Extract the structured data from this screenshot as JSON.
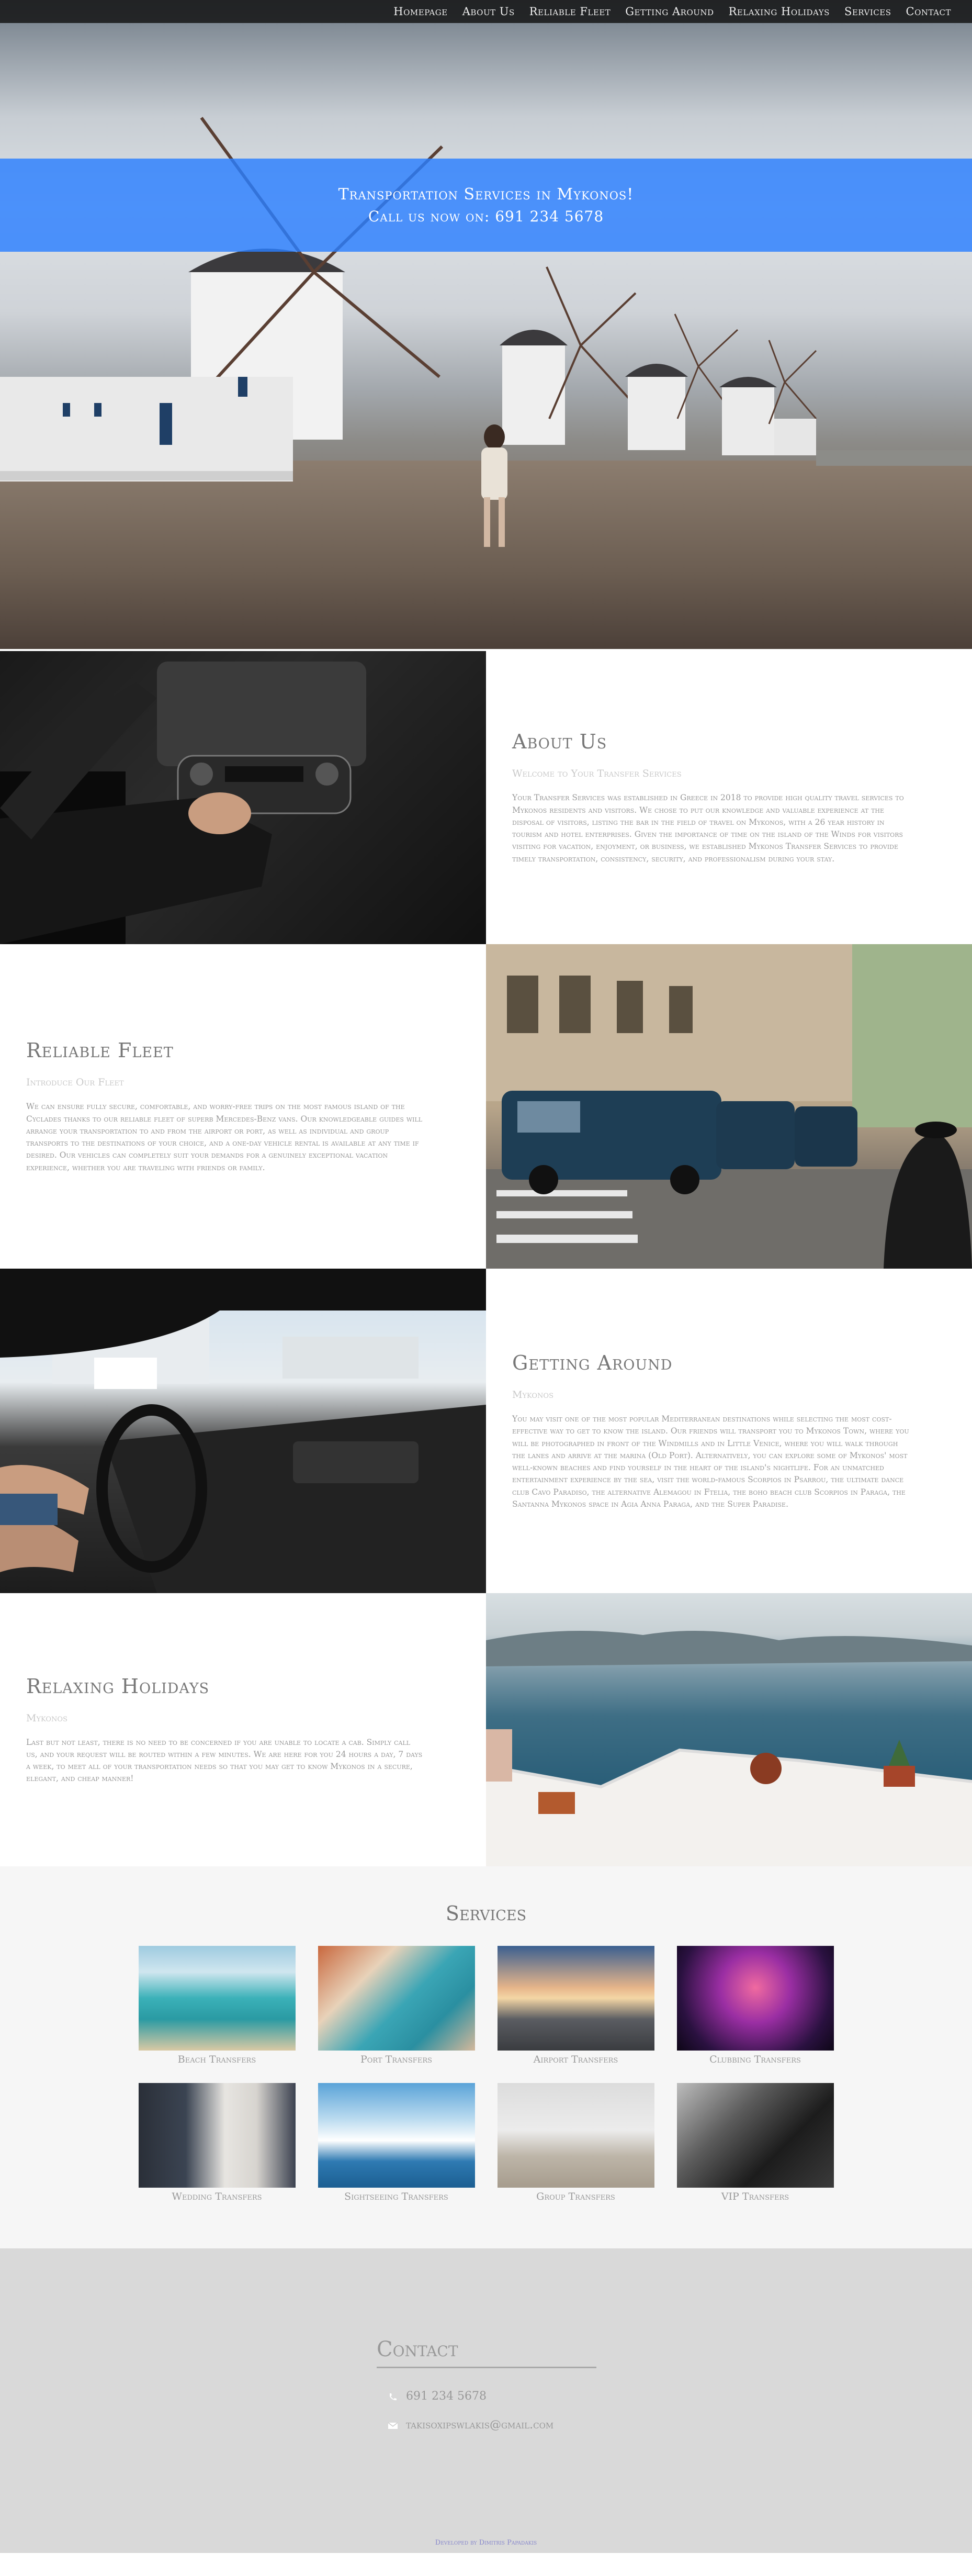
{
  "nav": {
    "items": [
      "Homepage",
      "About Us",
      "Reliable Fleet",
      "Getting Around",
      "Relaxing Holidays",
      "Services",
      "Contact"
    ]
  },
  "hero": {
    "line1": "Transportation Services in Mykonos!",
    "line2": "Call us now on: 691 234 5678"
  },
  "about": {
    "title": "About Us",
    "subtitle": "Welcome to Your Transfer Services",
    "body": "Your Transfer Services was established in Greece in 2018 to provide high quality travel services to Mykonos residents and visitors. We chose to put our knowledge and valuable experience at the disposal of visitors, listing the bar in the field of travel on Mykonos, with a 26 year history in tourism and hotel enterprises. Given the importance of time on the island of the Winds for visitors visiting for vacation, enjoyment, or business, we established Mykonos Transfer Services to provide timely transportation, consistency, security, and professionalism during your stay."
  },
  "fleet": {
    "title": "Reliable Fleet",
    "subtitle": "Introduce Our Fleet",
    "body": "We can ensure fully secure, comfortable, and worry-free trips on the most famous island of the Cyclades thanks to our reliable fleet of superb Mercedes-Benz vans. Our knowledgeable guides will arrange your transportation to and from the airport or port, as well as individual and group transports to the destinations of your choice, and a one-day vehicle rental is available at any time if desired. Our vehicles can completely suit your demands for a genuinely exceptional vacation experience, whether you are traveling with friends or family."
  },
  "around": {
    "title": "Getting Around",
    "subtitle": "Mykonos",
    "body": "You may visit one of the most popular Mediterranean destinations while selecting the most cost-effective way to get to know the island. Our friends will transport you to Mykonos Town, where you will be photographed in front of the Windmills and in Little Venice, where you will walk through the lanes and arrive at the marina (Old Port). Alternatively, you can explore some of Mykonos' most well-known beaches and find yourself in the heart of the island's nightlife. For an unmatched entertainment experience by the sea, visit the world-famous Scorpios in Psarrou, the ultimate dance club Cavo Paradiso, the alternative Alemagou in Ftelia, the boho beach club Scorpios in Paraga, the Santanna Mykonos space in Agia Anna Paraga, and the Super Paradise."
  },
  "holidays": {
    "title": "Relaxing Holidays",
    "subtitle": "Mykonos",
    "body": "Last but not least, there is no need to be concerned if you are unable to locate a cab. Simply call us, and your request will be routed within a few minutes. We are here for you 24 hours a day, 7 days a week, to meet all of your transportation needs so that you may get to know Mykonos in a secure, elegant, and cheap manner!"
  },
  "services": {
    "title": "Services",
    "items": [
      {
        "label": "Beach Transfers"
      },
      {
        "label": "Port Transfers"
      },
      {
        "label": "Airport Transfers"
      },
      {
        "label": "Clubbing Transfers"
      },
      {
        "label": "Wedding Transfers"
      },
      {
        "label": "Sightseeing Transfers"
      },
      {
        "label": "Group Transfers"
      },
      {
        "label": "VIP Transfers"
      }
    ]
  },
  "contact": {
    "title": "Contact",
    "phone": "691 234 5678",
    "email": "takisoxipswlakis@gmail.com"
  },
  "footer": {
    "text": "Developed by Dimitris Papadakis"
  }
}
